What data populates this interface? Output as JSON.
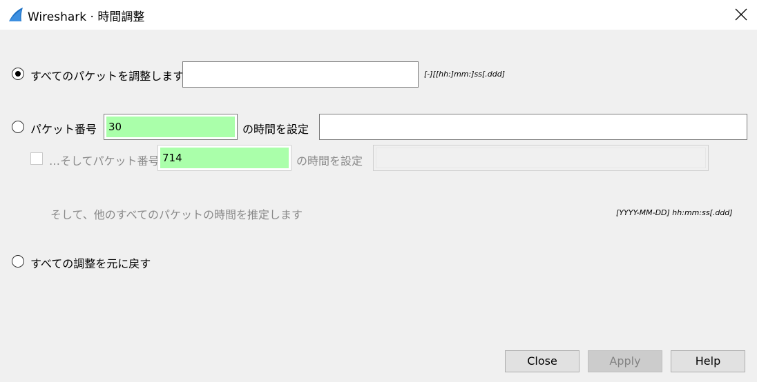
{
  "window": {
    "title": "Wireshark · 時間調整",
    "icon": "wireshark-fin-icon",
    "close_icon": "close-icon"
  },
  "adjust_all": {
    "label": "すべてのパケットを調整します",
    "selected": true,
    "value": "",
    "format_hint": "[-][[hh:]mm:]ss[.ddd]"
  },
  "set_packet": {
    "label": "パケット番号",
    "selected": false,
    "packet_number": "30",
    "time_label": "の時間を設定",
    "time_value": ""
  },
  "second_packet": {
    "label": "…そしてパケット番号",
    "checked": false,
    "packet_number": "714",
    "time_label": "の時間を設定",
    "time_value": ""
  },
  "extrapolate_note": "そして、他のすべてのパケットの時間を推定します",
  "datetime_hint": "[YYYY-MM-DD] hh:mm:ss[.ddd]",
  "undo_all": {
    "label": "すべての調整を元に戻す",
    "selected": false
  },
  "buttons": {
    "close": "Close",
    "apply": "Apply",
    "help": "Help"
  },
  "colors": {
    "valid_field": "#aaffaa",
    "titlebar": "#ffffff",
    "dialog_bg": "#f0f0f0"
  }
}
